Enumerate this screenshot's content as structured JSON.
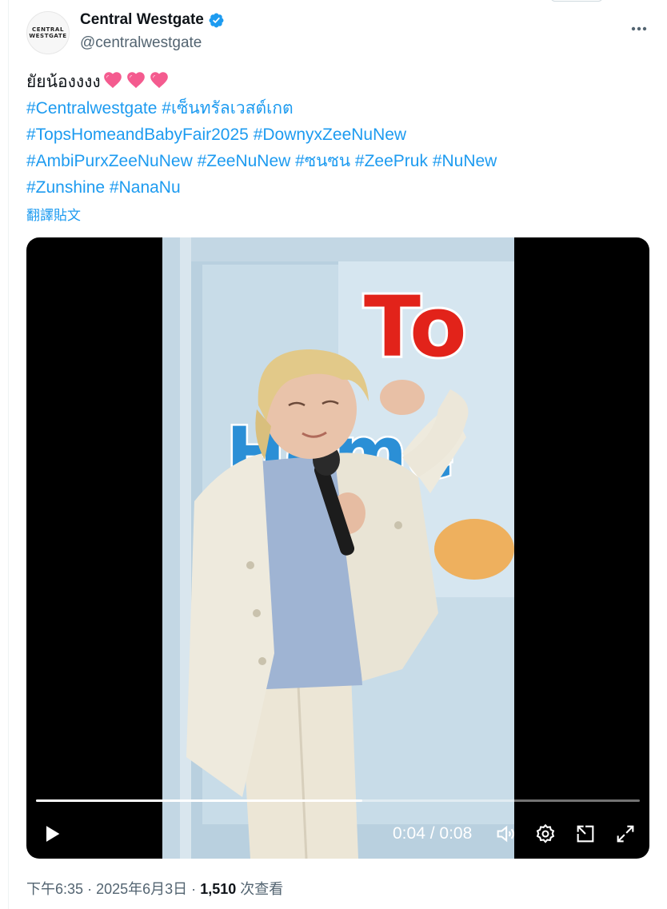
{
  "author": {
    "display_name": "Central Westgate",
    "handle": "@centralwestgate",
    "avatar_text_line1": "CENTRAL",
    "avatar_text_line2": "WESTGATE"
  },
  "tweet": {
    "line1_text": "ยัยน้องงงง",
    "line2": [
      "#Centralwestgate",
      "#เซ็นทรัลเวสต์เกต"
    ],
    "line3": [
      "#TopsHomeandBabyFair2025",
      "#DownyxZeeNuNew"
    ],
    "line4": [
      "#AmbiPurxZeeNuNew",
      "#ZeeNuNew",
      "#ซนซน",
      "#ZeePruk",
      "#NuNew"
    ],
    "line5": [
      "#Zunshine",
      "#NanaNu"
    ],
    "translate_label": "翻譯貼文"
  },
  "video": {
    "current_time": "0:04",
    "separator": "/",
    "duration": "0:08",
    "progress": 0.54,
    "sign_text_1": "To",
    "sign_text_2": "Home"
  },
  "meta": {
    "time": "下午6:35",
    "date": "2025年6月3日",
    "views_count": "1,510",
    "views_label": "次查看",
    "dot": "·"
  },
  "icons": {
    "verified": "verified-badge-icon",
    "more": "more-options-icon",
    "heart": "pink-heart-icon",
    "play": "play-icon",
    "volume": "volume-icon",
    "settings": "settings-gear-icon",
    "dock": "picture-in-picture-icon",
    "fullscreen": "fullscreen-icon"
  },
  "colors": {
    "link": "#1d9bf0",
    "secondary_text": "#536471",
    "primary_text": "#0f1419",
    "verified": "#1d9bf0"
  }
}
